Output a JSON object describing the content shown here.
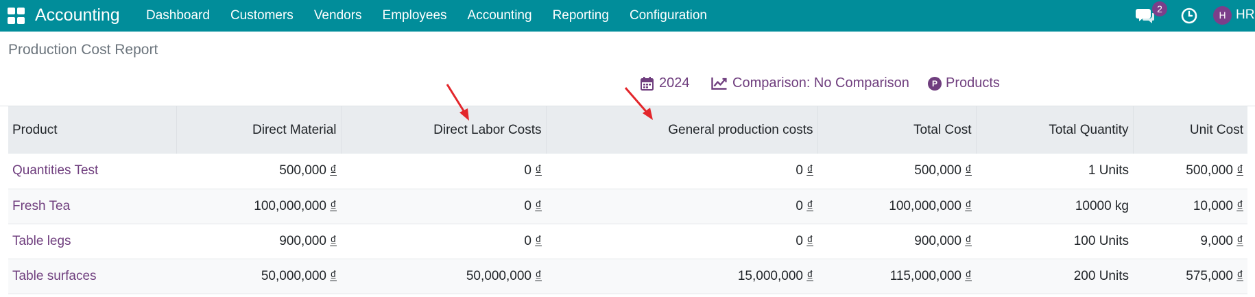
{
  "navbar": {
    "brand": "Accounting",
    "menu": [
      "Dashboard",
      "Customers",
      "Vendors",
      "Employees",
      "Accounting",
      "Reporting",
      "Configuration"
    ],
    "chat_count": "2",
    "avatar_letter": "H",
    "user": "HR",
    "colors": {
      "bar": "#018d9a",
      "badge": "#7b3f8a"
    },
    "icons": [
      "apps-grid-icon",
      "chat-icon",
      "clock-icon"
    ]
  },
  "page": {
    "title": "Production Cost Report"
  },
  "filters": {
    "year": "2024",
    "comparison": "Comparison: No Comparison",
    "products_badge": "P",
    "products": "Products",
    "icons": [
      "calendar-icon",
      "line-chart-icon",
      "products-icon"
    ],
    "accent": "#6f3e7e"
  },
  "table": {
    "columns": [
      "Product",
      "Direct Material",
      "Direct Labor Costs",
      "General production costs",
      "Total Cost",
      "Total Quantity",
      "Unit Cost"
    ],
    "currency": "₫",
    "rows": [
      {
        "product": "Quantities Test",
        "direct_material": "500,000",
        "direct_labor": "0",
        "general": "0",
        "total_cost": "500,000",
        "quantity": "1 Units",
        "unit_cost": "500,000"
      },
      {
        "product": "Fresh Tea",
        "direct_material": "100,000,000",
        "direct_labor": "0",
        "general": "0",
        "total_cost": "100,000,000",
        "quantity": "10000 kg",
        "unit_cost": "10,000"
      },
      {
        "product": "Table legs",
        "direct_material": "900,000",
        "direct_labor": "0",
        "general": "0",
        "total_cost": "900,000",
        "quantity": "100 Units",
        "unit_cost": "9,000"
      },
      {
        "product": "Table surfaces",
        "direct_material": "50,000,000",
        "direct_labor": "50,000,000",
        "general": "15,000,000",
        "total_cost": "115,000,000",
        "quantity": "200 Units",
        "unit_cost": "575,000"
      }
    ]
  },
  "annotations": {
    "arrow_color": "#e3262b",
    "arrows": [
      "arrow-direct-labor-costs",
      "arrow-general-production-costs"
    ]
  }
}
